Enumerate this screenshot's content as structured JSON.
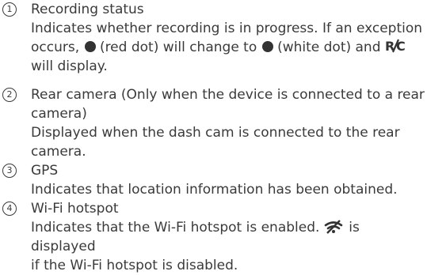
{
  "items": [
    {
      "number": "1",
      "title": "Recording status",
      "desc_lines": [
        "Indicates whether recording is in progress. If an exception",
        "occurs,",
        "(red dot) will change to",
        "(white dot) and",
        "will display."
      ]
    },
    {
      "number": "2",
      "title_lines": [
        "Rear camera (Only when the device is connected to a rear",
        "camera)"
      ],
      "desc_lines": [
        "Displayed when the dash cam is connected to the rear",
        "camera."
      ]
    },
    {
      "number": "3",
      "title": "GPS",
      "desc": "Indicates that location information has been obtained."
    },
    {
      "number": "4",
      "title": "Wi-Fi hotspot",
      "desc_lines": [
        "Indicates that the Wi-Fi hotspot is enabled.",
        "is displayed",
        "if the Wi-Fi hotspot is disabled."
      ]
    }
  ],
  "icons": {
    "red_dot": "record-dot-icon",
    "white_dot": "white-dot-icon",
    "rec_error": "rec-error-icon",
    "wifi_disabled": "wifi-disabled-icon"
  },
  "colors": {
    "text": "#3a3a3a",
    "icon": "#333333"
  }
}
